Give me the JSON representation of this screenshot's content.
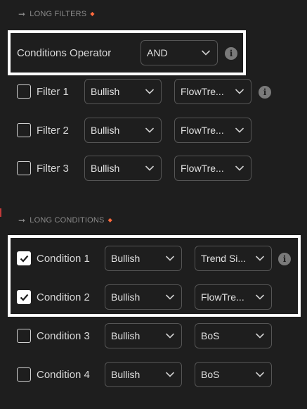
{
  "long_filters": {
    "header": "LONG FILTERS",
    "operator": {
      "label": "Conditions Operator",
      "value": "AND"
    },
    "rows": [
      {
        "label": "Filter 1",
        "checked": false,
        "direction": "Bullish",
        "source": "FlowTre..."
      },
      {
        "label": "Filter 2",
        "checked": false,
        "direction": "Bullish",
        "source": "FlowTre..."
      },
      {
        "label": "Filter 3",
        "checked": false,
        "direction": "Bullish",
        "source": "FlowTre..."
      }
    ]
  },
  "long_conditions": {
    "header": "LONG CONDITIONS",
    "rows": [
      {
        "label": "Condition 1",
        "checked": true,
        "direction": "Bullish",
        "source": "Trend Si..."
      },
      {
        "label": "Condition 2",
        "checked": true,
        "direction": "Bullish",
        "source": "FlowTre..."
      },
      {
        "label": "Condition 3",
        "checked": false,
        "direction": "Bullish",
        "source": "BoS"
      },
      {
        "label": "Condition 4",
        "checked": false,
        "direction": "Bullish",
        "source": "BoS"
      }
    ]
  },
  "icons": {
    "header_arrow": "arrow-right-icon",
    "dropdown": "chevron-down-icon",
    "info": "info-icon",
    "check": "check-icon"
  },
  "colors": {
    "background": "#1e1e1e",
    "accent_dot": "#ff6a3d",
    "highlight_border": "#ffffff"
  }
}
